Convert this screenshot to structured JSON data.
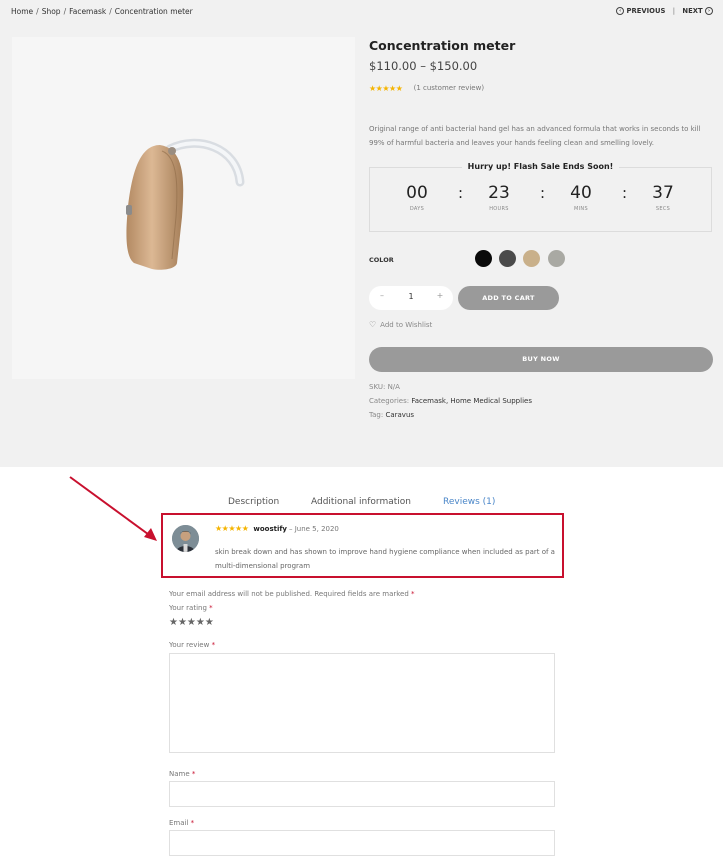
{
  "breadcrumb": {
    "items": [
      "Home",
      "Shop",
      "Facemask",
      "Concentration meter"
    ],
    "separator": "/"
  },
  "nav": {
    "previous": "PREVIOUS",
    "next": "NEXT",
    "divider": "|"
  },
  "product": {
    "title": "Concentration meter",
    "price": "$110.00 – $150.00",
    "rating_stars": "★★★★★",
    "review_count": "(1 customer review)",
    "description": "Original range of anti bacterial hand gel has an advanced formula that works in seconds to kill 99% of harmful bacteria and leaves your hands feeling clean and smelling lovely.",
    "image_icon": "hearing-aid-icon"
  },
  "flash_sale": {
    "title": "Hurry up! Flash Sale Ends Soon!",
    "units": [
      {
        "value": "00",
        "label": "DAYS"
      },
      {
        "value": "23",
        "label": "HOURS"
      },
      {
        "value": "40",
        "label": "MINS"
      },
      {
        "value": "37",
        "label": "SECS"
      }
    ],
    "colon": ":"
  },
  "color": {
    "label": "COLOR",
    "swatches": [
      "#0a0a0a",
      "#4a4a4a",
      "#c9b08a",
      "#a9a9a3"
    ]
  },
  "cart": {
    "minus": "–",
    "quantity": "1",
    "plus": "+",
    "add_to_cart": "ADD TO CART",
    "wishlist": "Add to Wishlist",
    "buy_now": "BUY NOW"
  },
  "meta": {
    "sku_label": "SKU:",
    "sku_value": "N/A",
    "categories_label": "Categories:",
    "categories_value": "Facemask, Home Medical Supplies",
    "tag_label": "Tag:",
    "tag_value": "Caravus"
  },
  "tabs": [
    {
      "label": "Description",
      "active": false
    },
    {
      "label": "Additional information",
      "active": false
    },
    {
      "label": "Reviews (1)",
      "active": true
    }
  ],
  "review": {
    "stars": "★★★★★",
    "author": "woostify",
    "date": "– June 5, 2020",
    "text": "skin break down and has shown to improve hand hygiene compliance when included as part of a multi-dimensional program"
  },
  "form": {
    "note": "Your email address will not be published. Required fields are marked",
    "required_mark": "*",
    "rating_label": "Your rating",
    "rating_stars": "★★★★★",
    "review_label": "Your review",
    "name_label": "Name",
    "email_label": "Email"
  },
  "colors": {
    "accent": "#4a86c8",
    "highlight": "#c8102e",
    "button": "#9a9a9a",
    "star": "#f5b400"
  }
}
